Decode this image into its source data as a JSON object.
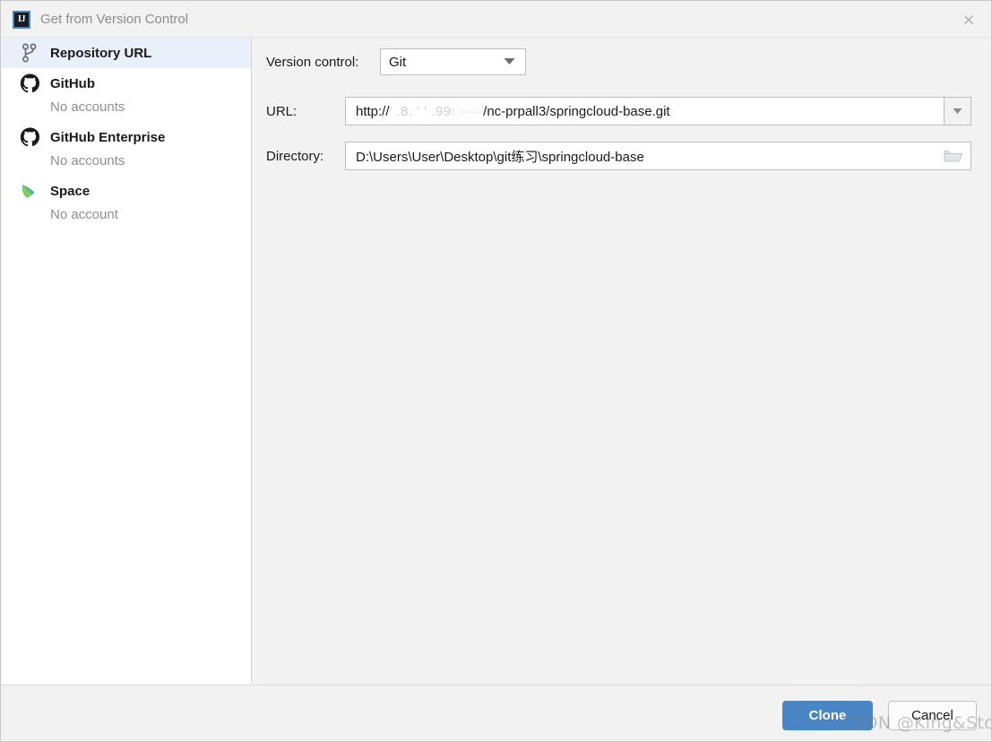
{
  "window": {
    "title": "Get from Version Control",
    "app_icon": "intellij-idea-icon",
    "app_icon_text": "IJ",
    "close_icon": "close-icon"
  },
  "sidebar": {
    "items": [
      {
        "label": "Repository URL",
        "sub": "",
        "icon": "git-branch-icon",
        "selected": true
      },
      {
        "label": "GitHub",
        "sub": "No accounts",
        "icon": "github-icon",
        "selected": false
      },
      {
        "label": "GitHub Enterprise",
        "sub": "No accounts",
        "icon": "github-icon",
        "selected": false
      },
      {
        "label": "Space",
        "sub": "No account",
        "icon": "jetbrains-space-icon",
        "selected": false
      }
    ]
  },
  "form": {
    "version_control": {
      "label": "Version control:",
      "value": "Git",
      "options": [
        "Git"
      ],
      "caret_icon": "chevron-down-icon"
    },
    "url": {
      "label": "URL:",
      "value_prefix": "http://",
      "value_redacted": "′ .8. ′ ′ .99: ····",
      "value_suffix": " /nc-prpall3/springcloud-base.git",
      "full_value": "http:// ′ .8. ′ ′ .99: ···· /nc-prpall3/springcloud-base.git",
      "placeholder": "",
      "dropdown_icon": "chevron-down-icon"
    },
    "directory": {
      "label": "Directory:",
      "value": "D:\\Users\\User\\Desktop\\git练习\\springcloud-base",
      "placeholder": "",
      "browse_icon": "folder-icon"
    }
  },
  "footer": {
    "clone_label": "Clone",
    "cancel_label": "Cancel"
  },
  "watermark": {
    "text": "CSDN @King&Stones"
  },
  "colors": {
    "accent": "#4a86c5",
    "selected_row": "#e9f0f9",
    "panel_bg": "#f2f2f2",
    "sidebar_bg": "#ffffff",
    "muted_text": "#8e8e8e"
  }
}
